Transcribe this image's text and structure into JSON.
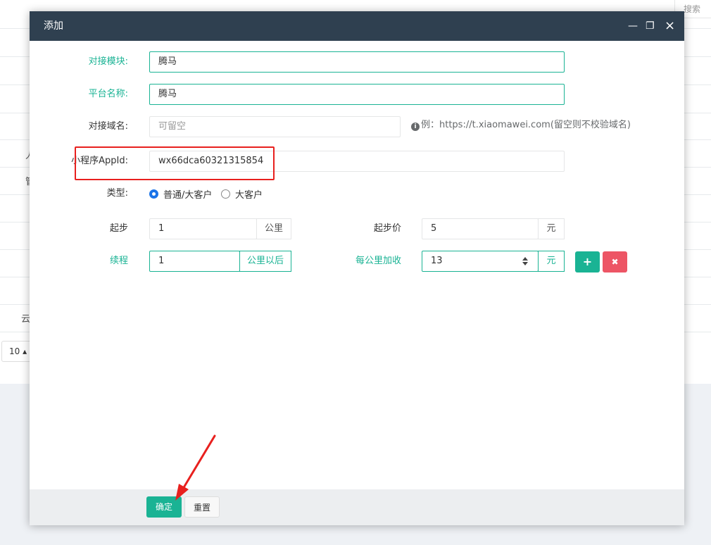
{
  "background": {
    "search_label": "搜索",
    "row_text_1": "人",
    "row_text_2": "管",
    "row_text_3": "云",
    "pager_value": "10 ▴"
  },
  "modal": {
    "title": "添加",
    "minimize_glyph": "—",
    "maximize_glyph": "❐",
    "close_glyph": "×"
  },
  "form": {
    "module": {
      "label": "对接模块:",
      "value": "腾马"
    },
    "platform_name": {
      "label": "平台名称:",
      "value": "腾马"
    },
    "domain": {
      "label": "对接域名:",
      "placeholder": "可留空",
      "hint_icon": "i",
      "hint": "例：https://t.xiaomawei.com(留空则不校验域名)"
    },
    "appid": {
      "label": "小程序AppId:",
      "value": "wx66dca60321315854"
    },
    "type": {
      "label": "类型:",
      "options": [
        "普通/大客户",
        "大客户"
      ],
      "selected": "普通/大客户"
    },
    "start_distance": {
      "label": "起步",
      "value": "1",
      "unit": "公里"
    },
    "start_price": {
      "label": "起步价",
      "value": "5",
      "unit": "元"
    },
    "extra_distance": {
      "label": "续程",
      "value": "1",
      "unit": "公里以后"
    },
    "per_km_add": {
      "label": "每公里加收",
      "value": "13",
      "unit": "元"
    },
    "add_row_icon": "+",
    "remove_row_icon": "✖"
  },
  "footer": {
    "confirm_label": "确定",
    "reset_label": "重置"
  },
  "colors": {
    "accent_green": "#1ab394",
    "danger_red": "#ed5565",
    "header_dark": "#2f4050",
    "annotation_red": "#e8201e"
  }
}
